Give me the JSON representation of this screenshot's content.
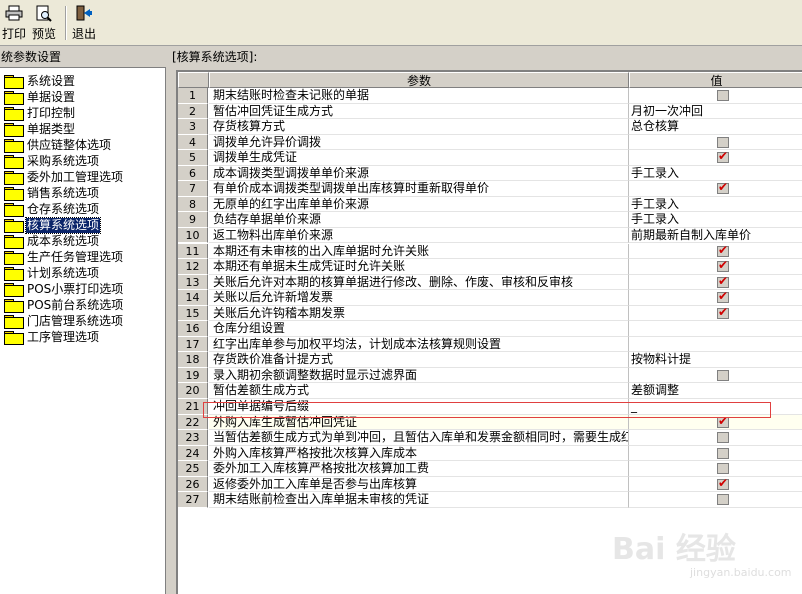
{
  "toolbar": {
    "print_label": "打印",
    "preview_label": "预览",
    "exit_label": "退出"
  },
  "left_panel": {
    "title": "统参数设置",
    "items": [
      {
        "label": "系统设置"
      },
      {
        "label": "单据设置"
      },
      {
        "label": "打印控制"
      },
      {
        "label": "单据类型"
      },
      {
        "label": "供应链整体选项"
      },
      {
        "label": "采购系统选项"
      },
      {
        "label": "委外加工管理选项"
      },
      {
        "label": "销售系统选项"
      },
      {
        "label": "仓存系统选项"
      },
      {
        "label": "核算系统选项",
        "selected": true
      },
      {
        "label": "成本系统选项"
      },
      {
        "label": "生产任务管理选项"
      },
      {
        "label": "计划系统选项"
      },
      {
        "label": "POS小票打印选项"
      },
      {
        "label": "POS前台系统选项"
      },
      {
        "label": "门店管理系统选项"
      },
      {
        "label": "工序管理选项"
      }
    ]
  },
  "right_panel": {
    "title": "[核算系统选项]:",
    "columns": {
      "param": "参数",
      "value": "值"
    },
    "rows": [
      {
        "no": "1",
        "param": "期末结账时检查未记账的单据",
        "type": "checkbox",
        "checked": false
      },
      {
        "no": "2",
        "param": "暂估冲回凭证生成方式",
        "type": "text",
        "value": "月初一次冲回"
      },
      {
        "no": "3",
        "param": "存货核算方式",
        "type": "text",
        "value": "总仓核算"
      },
      {
        "no": "4",
        "param": "调拨单允许异价调拨",
        "type": "checkbox",
        "checked": false
      },
      {
        "no": "5",
        "param": "调拨单生成凭证",
        "type": "checkbox",
        "checked": true
      },
      {
        "no": "6",
        "param": "成本调拨类型调拨单单价来源",
        "type": "text",
        "value": "手工录入"
      },
      {
        "no": "7",
        "param": "有单价成本调拨类型调拨单出库核算时重新取得单价",
        "type": "checkbox",
        "checked": true
      },
      {
        "no": "8",
        "param": "无原单的红字出库单单价来源",
        "type": "text",
        "value": "手工录入"
      },
      {
        "no": "9",
        "param": "负结存单据单价来源",
        "type": "text",
        "value": "手工录入"
      },
      {
        "no": "10",
        "param": "返工物料出库单价来源",
        "type": "text",
        "value": "前期最新自制入库单价"
      },
      {
        "no": "11",
        "param": "本期还有未审核的出入库单据时允许关账",
        "type": "checkbox",
        "checked": true
      },
      {
        "no": "12",
        "param": "本期还有单据未生成凭证时允许关账",
        "type": "checkbox",
        "checked": true
      },
      {
        "no": "13",
        "param": "关账后允许对本期的核算单据进行修改、删除、作废、审核和反审核",
        "type": "checkbox",
        "checked": true
      },
      {
        "no": "14",
        "param": "关账以后允许新增发票",
        "type": "checkbox",
        "checked": true
      },
      {
        "no": "15",
        "param": "关账后允许钩稽本期发票",
        "type": "checkbox",
        "checked": true
      },
      {
        "no": "16",
        "param": "仓库分组设置",
        "type": "text",
        "value": ""
      },
      {
        "no": "17",
        "param": "红字出库单参与加权平均法，计划成本法核算规则设置",
        "type": "text",
        "value": ""
      },
      {
        "no": "18",
        "param": "存货跌价准备计提方式",
        "type": "text",
        "value": "按物料计提"
      },
      {
        "no": "19",
        "param": "录入期初余额调整数据时显示过滤界面",
        "type": "checkbox",
        "checked": false
      },
      {
        "no": "20",
        "param": "暂估差额生成方式",
        "type": "text",
        "value": "差额调整"
      },
      {
        "no": "21",
        "param": "冲回单据编号后缀",
        "type": "text",
        "value": "_"
      },
      {
        "no": "22",
        "param": "外购入库生成暂估冲回凭证",
        "type": "checkbox",
        "checked": true,
        "highlight": true
      },
      {
        "no": "23",
        "param": "当暂估差额生成方式为单到冲回，且暂估入库单和发票金额相同时，需要生成红",
        "type": "checkbox",
        "checked": false
      },
      {
        "no": "24",
        "param": "外购入库核算严格按批次核算入库成本",
        "type": "checkbox",
        "checked": false
      },
      {
        "no": "25",
        "param": "委外加工入库核算严格按批次核算加工费",
        "type": "checkbox",
        "checked": false
      },
      {
        "no": "26",
        "param": "返修委外加工入库单是否参与出库核算",
        "type": "checkbox",
        "checked": true
      },
      {
        "no": "27",
        "param": "期末结账前检查出入库单据未审核的凭证",
        "type": "checkbox",
        "checked": false
      }
    ]
  },
  "watermark": {
    "text": "Bai 经验",
    "sub": "jingyan.baidu.com"
  }
}
